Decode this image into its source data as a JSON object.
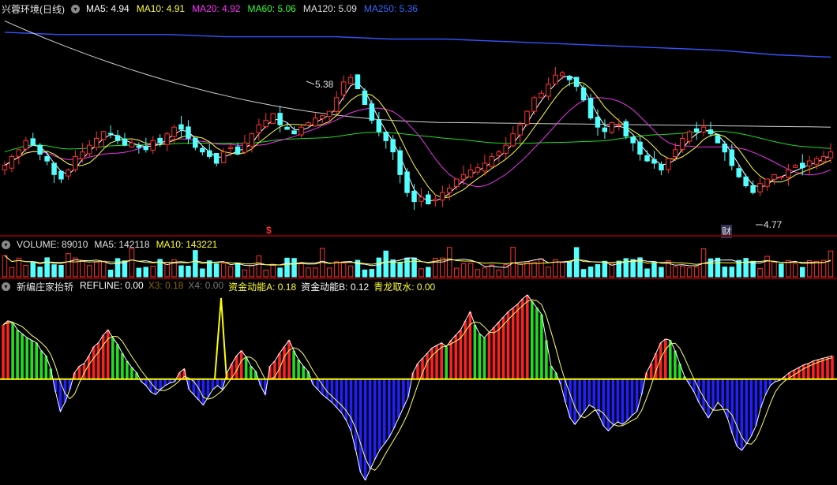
{
  "main": {
    "title": "兴蓉环境(日线)",
    "ma": [
      {
        "label": "MA5:",
        "value": "4.94",
        "color": "#ffffff"
      },
      {
        "label": "MA10:",
        "value": "4.91",
        "color": "#ffff33"
      },
      {
        "label": "MA20:",
        "value": "4.92",
        "color": "#ff33ff"
      },
      {
        "label": "MA60:",
        "value": "5.06",
        "color": "#33ff33"
      },
      {
        "label": "MA120:",
        "value": "5.09",
        "color": "#dddddd"
      },
      {
        "label": "MA250:",
        "value": "5.36",
        "color": "#3366ff"
      }
    ],
    "high_label": "5.38",
    "low_label": "4.77",
    "marker_dollar": "$",
    "marker_cai": "财"
  },
  "volume": {
    "title": "VOLUME:",
    "value": "89010",
    "ma5_label": "MA5:",
    "ma5_value": "142118",
    "ma10_label": "MA10:",
    "ma10_value": "143221"
  },
  "indicator": {
    "title": "新编庄家抬轿",
    "items": [
      {
        "label": "REFLINE:",
        "value": "0.00",
        "color": "#ffffff"
      },
      {
        "label": "X3:",
        "value": "0.18",
        "color": "#886600"
      },
      {
        "label": "X4:",
        "value": "0.00",
        "color": "#777777"
      },
      {
        "label": "资金动能A:",
        "value": "0.18",
        "color": "#ffff33"
      },
      {
        "label": "资金动能B:",
        "value": "0.12",
        "color": "#ffffff"
      },
      {
        "label": "青龙取水:",
        "value": "0.00",
        "color": "#ffff33"
      }
    ]
  },
  "colors": {
    "up": "#ff3333",
    "down": "#54ffff",
    "bg": "#000000",
    "hist_up": "#ff2020",
    "hist_down": "#2020ff",
    "hist_green": "#22dd22",
    "refline": "#ffff00"
  },
  "chart_data": [
    {
      "type": "candlestick",
      "name": "price",
      "ylim": [
        4.6,
        5.55
      ],
      "close": [
        4.88,
        4.92,
        4.95,
        4.99,
        4.97,
        4.93,
        4.9,
        4.84,
        4.82,
        4.86,
        4.92,
        4.94,
        4.97,
        5.0,
        5.03,
        5.02,
        4.99,
        4.97,
        4.98,
        4.96,
        4.95,
        4.99,
        4.98,
        5.02,
        5.05,
        5.04,
        5.0,
        4.96,
        4.94,
        4.92,
        4.89,
        4.94,
        4.96,
        4.93,
        4.98,
        5.02,
        5.06,
        5.08,
        5.11,
        5.06,
        5.04,
        5.02,
        5.05,
        5.07,
        5.09,
        5.1,
        5.12,
        5.18,
        5.25,
        5.27,
        5.22,
        5.15,
        5.08,
        5.03,
        4.99,
        4.94,
        4.84,
        4.76,
        4.72,
        4.74,
        4.71,
        4.73,
        4.76,
        4.78,
        4.82,
        4.84,
        4.86,
        4.87,
        4.89,
        4.92,
        4.94,
        4.97,
        5.02,
        5.06,
        5.12,
        5.18,
        5.2,
        5.24,
        5.28,
        5.29,
        5.26,
        5.23,
        5.17,
        5.09,
        5.05,
        5.03,
        5.07,
        5.06,
        5.01,
        4.98,
        4.93,
        4.9,
        4.89,
        4.86,
        4.91,
        4.95,
        5.0,
        5.03,
        5.03,
        5.05,
        5.02,
        4.98,
        4.94,
        4.88,
        4.83,
        4.79,
        4.76,
        4.8,
        4.82,
        4.84,
        4.83,
        4.86,
        4.88,
        4.87,
        4.9,
        4.91,
        4.92,
        4.94
      ],
      "high_marker": 5.38,
      "low_marker": 4.77,
      "ma250": [
        5.47,
        5.46,
        5.46,
        5.46,
        5.45,
        5.45,
        5.45,
        5.44,
        5.44,
        5.43,
        5.42,
        5.41,
        5.4,
        5.39,
        5.37,
        5.36
      ]
    },
    {
      "type": "bar",
      "name": "volume",
      "ma5": 142118,
      "ma10": 143221,
      "last": 89010
    },
    {
      "type": "bar",
      "name": "capital-momentum",
      "ylim": [
        -0.8,
        0.65
      ],
      "values": [
        0.42,
        0.45,
        0.44,
        0.38,
        0.35,
        0.32,
        0.3,
        0.28,
        0.22,
        0.18,
        0.08,
        -0.1,
        -0.25,
        -0.18,
        -0.08,
        0.05,
        0.1,
        0.12,
        0.18,
        0.25,
        0.28,
        0.34,
        0.38,
        0.32,
        0.27,
        0.2,
        0.14,
        0.09,
        0.05,
        -0.02,
        -0.05,
        -0.1,
        -0.12,
        -0.08,
        -0.05,
        -0.03,
        -0.02,
        0.05,
        0.08,
        -0.08,
        -0.12,
        -0.16,
        -0.2,
        -0.14,
        -0.08,
        -0.05,
        -0.08,
        0.05,
        0.12,
        0.18,
        0.22,
        0.17,
        0.1,
        0.06,
        -0.05,
        -0.12,
        0.1,
        0.14,
        0.2,
        0.25,
        0.3,
        0.22,
        0.15,
        0.1,
        0.06,
        -0.04,
        -0.08,
        -0.12,
        -0.15,
        -0.18,
        -0.22,
        -0.26,
        -0.32,
        -0.4,
        -0.55,
        -0.72,
        -0.78,
        -0.7,
        -0.62,
        -0.55,
        -0.5,
        -0.45,
        -0.38,
        -0.3,
        -0.22,
        -0.14,
        0.05,
        0.12,
        0.16,
        0.2,
        0.24,
        0.26,
        0.28,
        0.25,
        0.3,
        0.34,
        0.38,
        0.45,
        0.52,
        0.42,
        0.35,
        0.32,
        0.36,
        0.4,
        0.44,
        0.48,
        0.52,
        0.55,
        0.58,
        0.62,
        0.65,
        0.6,
        0.55,
        0.5,
        0.3,
        0.1,
        0.05,
        -0.04,
        -0.18,
        -0.3,
        -0.35,
        -0.3,
        -0.25,
        -0.2,
        -0.22,
        -0.28,
        -0.36,
        -0.4,
        -0.36,
        -0.33,
        -0.35,
        -0.32,
        -0.28,
        -0.25,
        -0.12,
        0.05,
        0.12,
        0.2,
        0.28,
        0.31,
        0.3,
        0.22,
        0.12,
        0.02,
        -0.04,
        -0.1,
        -0.18,
        -0.24,
        -0.3,
        -0.24,
        -0.18,
        -0.22,
        -0.3,
        -0.42,
        -0.52,
        -0.55,
        -0.5,
        -0.44,
        -0.36,
        -0.22,
        -0.12,
        -0.05,
        -0.02,
        -0.01,
        0.02,
        0.05,
        0.07,
        0.09,
        0.11,
        0.12,
        0.14,
        0.15,
        0.16,
        0.17,
        0.18
      ]
    }
  ]
}
